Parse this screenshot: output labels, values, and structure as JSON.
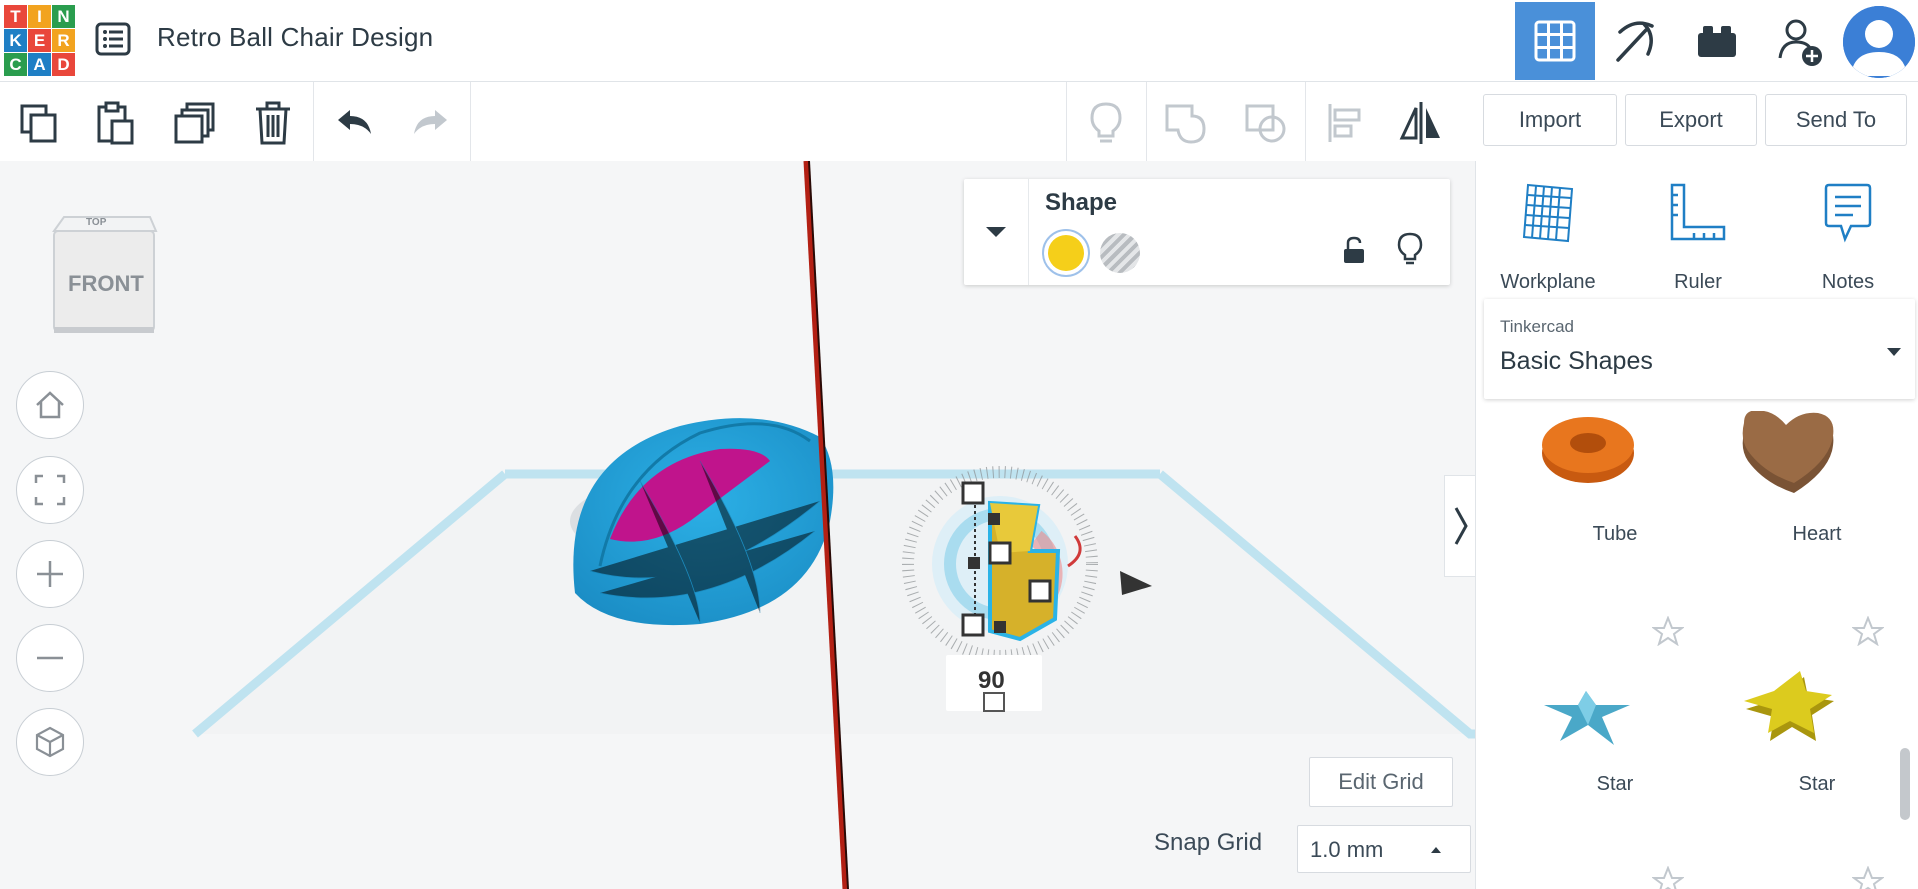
{
  "app": {
    "logo_letters": [
      "T",
      "I",
      "N",
      "K",
      "E",
      "R",
      "C",
      "A",
      "D"
    ],
    "logo_colors": [
      "#e9473b",
      "#f2a31f",
      "#2a9d4e",
      "#1f7fc5",
      "#e9473b",
      "#f2a31f",
      "#2a9d4e",
      "#1f7fc5",
      "#e9473b"
    ],
    "title": "Retro Ball Chair Design",
    "accent": "#4a90d9"
  },
  "header_buttons": [
    {
      "name": "3d-design-view",
      "icon": "grid-icon",
      "active": true
    },
    {
      "name": "codeblocks-view",
      "icon": "pickaxe-icon",
      "active": false
    },
    {
      "name": "bricks-view",
      "icon": "brick-icon",
      "active": false
    },
    {
      "name": "invite-user",
      "icon": "add-user-icon",
      "active": false
    },
    {
      "name": "profile",
      "icon": "avatar-icon",
      "active": false
    }
  ],
  "toolbar": {
    "tools": [
      "copy-icon",
      "paste-icon",
      "duplicate-icon",
      "delete-icon",
      "undo-icon",
      "redo-icon"
    ],
    "right_tools": [
      "note-lightbulb-icon",
      "group-icon",
      "ungroup-icon",
      "align-icon",
      "mirror-icon"
    ]
  },
  "actions": {
    "import": "Import",
    "export": "Export",
    "send_to": "Send To"
  },
  "viewcube": {
    "front": "FRONT",
    "top": "TOP"
  },
  "nav_controls": [
    "home-view-icon",
    "fit-view-icon",
    "zoom-in-icon",
    "zoom-out-icon",
    "ortho-perspective-icon"
  ],
  "shape_panel": {
    "title": "Shape",
    "solid_color": "#f5cf1a"
  },
  "rotation": {
    "angle": "90"
  },
  "grid": {
    "edit_grid": "Edit Grid",
    "snap_label": "Snap Grid",
    "snap_value": "1.0 mm"
  },
  "right_panel": {
    "tools": [
      {
        "label": "Workplane",
        "icon": "workplane-icon"
      },
      {
        "label": "Ruler",
        "icon": "ruler-icon"
      },
      {
        "label": "Notes",
        "icon": "notes-icon"
      }
    ],
    "library": {
      "category": "Tinkercad",
      "name": "Basic Shapes"
    },
    "shapes": [
      {
        "label": "Tube"
      },
      {
        "label": "Heart"
      },
      {
        "label": "Star"
      },
      {
        "label": "Star"
      }
    ]
  }
}
